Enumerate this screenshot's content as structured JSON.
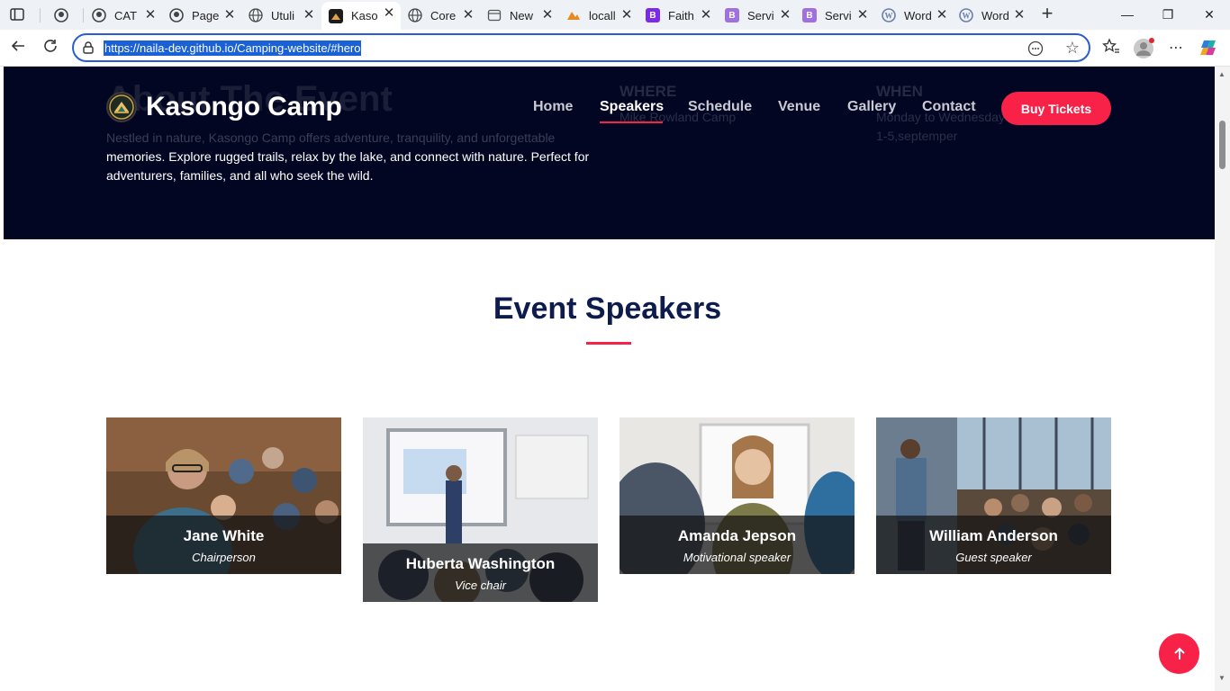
{
  "browser": {
    "tabs": [
      {
        "label": "",
        "icon": "github-icon"
      },
      {
        "label": "CAT",
        "icon": "github-icon"
      },
      {
        "label": "Page",
        "icon": "github-icon"
      },
      {
        "label": "Utuli",
        "icon": "globe-icon"
      },
      {
        "label": "Kaso",
        "icon": "kasongo-icon",
        "active": true
      },
      {
        "label": "Core",
        "icon": "globe-icon"
      },
      {
        "label": "New",
        "icon": "newtab-icon"
      },
      {
        "label": "locall",
        "icon": "pma-icon"
      },
      {
        "label": "Faith",
        "icon": "bootstrap-icon"
      },
      {
        "label": "Servi",
        "icon": "bootstrap-icon"
      },
      {
        "label": "Servi",
        "icon": "bootstrap-icon"
      },
      {
        "label": "Word",
        "icon": "wordpress-icon"
      },
      {
        "label": "Word",
        "icon": "wordpress-icon"
      }
    ],
    "url": "https://naila-dev.github.io/Camping-website/#hero"
  },
  "hero": {
    "about_title": "About The Event",
    "about_text_dim": "Nestled in nature, Kasongo Camp offers adventure, tranquility, and unforgettable",
    "about_text": "memories. Explore rugged trails, relax by the lake, and connect with nature. Perfect for adventurers, families, and all who seek the wild.",
    "where_label": "WHERE",
    "where_value": "Mike Rowland Camp",
    "when_label": "WHEN",
    "when_value_1": "Monday to Wednesday",
    "when_value_2": "1-5,septemper"
  },
  "header": {
    "logo_text": "Kasongo Camp",
    "nav": [
      "Home",
      "Speakers",
      "Schedule",
      "Venue",
      "Gallery",
      "Contact"
    ],
    "active_nav": "Speakers",
    "cta": "Buy Tickets"
  },
  "speakers": {
    "title": "Event Speakers",
    "items": [
      {
        "name": "Jane White",
        "role": "Chairperson"
      },
      {
        "name": "Huberta Washington",
        "role": "Vice chair"
      },
      {
        "name": "Amanda Jepson",
        "role": "Motivational speaker"
      },
      {
        "name": "William Anderson",
        "role": "Guest speaker"
      }
    ]
  },
  "colors": {
    "accent": "#f82249",
    "hero_bg": "#030622",
    "heading": "#0e1b4d"
  }
}
